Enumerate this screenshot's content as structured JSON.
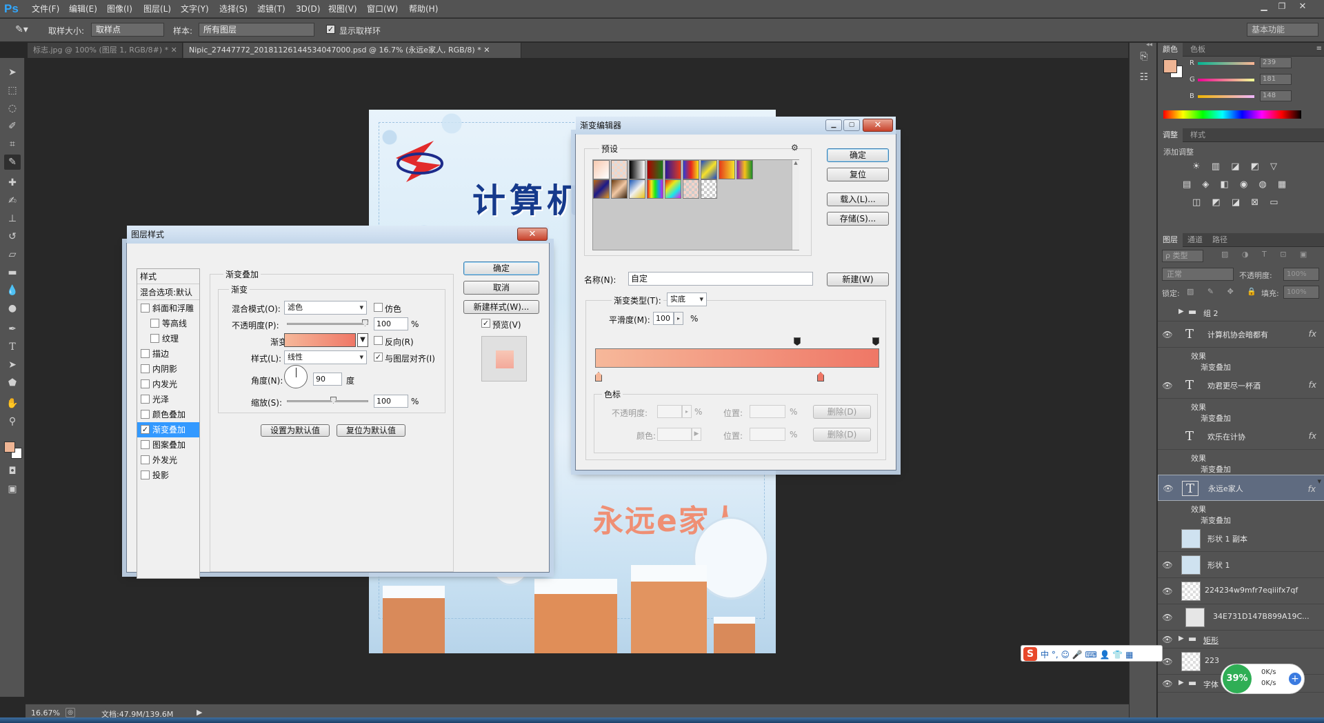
{
  "app": {
    "logo": "Ps"
  },
  "menu": [
    "文件(F)",
    "编辑(E)",
    "图像(I)",
    "图层(L)",
    "文字(Y)",
    "选择(S)",
    "滤镜(T)",
    "3D(D)",
    "视图(V)",
    "窗口(W)",
    "帮助(H)"
  ],
  "options": {
    "sample_size_label": "取样大小:",
    "sample_size_value": "取样点",
    "sample_label": "样本:",
    "sample_value": "所有图层",
    "show_ring_label": "显示取样环",
    "workspace": "基本功能"
  },
  "tabs": [
    {
      "label": "标志.jpg @ 100% (图层 1, RGB/8#) *"
    },
    {
      "label": "Nipic_27447772_20181126144534047000.psd @ 16.7% (永远e家人, RGB/8) *"
    }
  ],
  "status": {
    "zoom": "16.67%",
    "doc": "文档:47.9M/139.6M"
  },
  "doc_texts": {
    "headline": "计算机",
    "family": "永远e家人"
  },
  "color_panel": {
    "tabs": [
      "颜色",
      "色板"
    ],
    "channels": [
      {
        "name": "R",
        "value": "239"
      },
      {
        "name": "G",
        "value": "181"
      },
      {
        "name": "B",
        "value": "148"
      }
    ],
    "fg_color": "#efb594"
  },
  "adjust_panel": {
    "tabs": [
      "调整",
      "样式"
    ],
    "title": "添加调整"
  },
  "layers_panel": {
    "tabs": [
      "图层",
      "通道",
      "路径"
    ],
    "filter_label": "ρ 类型",
    "blend_mode": "正常",
    "opacity_label": "不透明度:",
    "opacity_value": "100%",
    "lock_label": "锁定:",
    "fill_label": "填充:",
    "fill_value": "100%",
    "effect_label": "效果",
    "effect_item": "渐变叠加",
    "layers": [
      {
        "name": "组 2",
        "kind": "group",
        "visible": false
      },
      {
        "name": "计算机协会暗都有",
        "kind": "text",
        "visible": true,
        "fx": true
      },
      {
        "name": "劝君更尽一杯酒",
        "kind": "text",
        "visible": true,
        "fx": true
      },
      {
        "name": "欢乐在计协",
        "kind": "text",
        "visible": false,
        "fx": true
      },
      {
        "name": "永远e家人",
        "kind": "text",
        "visible": true,
        "fx": true,
        "selected": true
      },
      {
        "name": "形状 1 副本",
        "kind": "shape",
        "visible": false
      },
      {
        "name": "形状 1",
        "kind": "shape",
        "visible": true
      },
      {
        "name": "224234w9mfr7eqiiifx7qf",
        "kind": "image",
        "visible": true
      },
      {
        "name": "34E731D147B899A19C...",
        "kind": "image",
        "visible": true
      },
      {
        "name": "矩形",
        "kind": "group",
        "visible": true
      },
      {
        "name": "223",
        "kind": "image",
        "visible": true
      },
      {
        "name": "字体",
        "kind": "group",
        "visible": true
      }
    ]
  },
  "layer_style": {
    "title": "图层样式",
    "close": "✕",
    "list_header": "样式",
    "blend_options": "混合选项:默认",
    "items": [
      {
        "label": "斜面和浮雕",
        "checked": false
      },
      {
        "label": "等高线",
        "checked": false,
        "sub": true
      },
      {
        "label": "纹理",
        "checked": false,
        "sub": true
      },
      {
        "label": "描边",
        "checked": false
      },
      {
        "label": "内阴影",
        "checked": false
      },
      {
        "label": "内发光",
        "checked": false
      },
      {
        "label": "光泽",
        "checked": false
      },
      {
        "label": "颜色叠加",
        "checked": false
      },
      {
        "label": "渐变叠加",
        "checked": true,
        "selected": true
      },
      {
        "label": "图案叠加",
        "checked": false
      },
      {
        "label": "外发光",
        "checked": false
      },
      {
        "label": "投影",
        "checked": false
      }
    ],
    "section_title": "渐变叠加",
    "group_title": "渐变",
    "blend_mode_label": "混合模式(O):",
    "blend_mode_value": "滤色",
    "dither_label": "仿色",
    "opacity_label": "不透明度(P):",
    "opacity_value": "100",
    "gradient_label": "渐变:",
    "reverse_label": "反向(R)",
    "style_label": "样式(L):",
    "style_value": "线性",
    "align_label": "与图层对齐(I)",
    "angle_label": "角度(N):",
    "angle_value": "90",
    "angle_unit": "度",
    "scale_label": "缩放(S):",
    "scale_value": "100",
    "percent": "%",
    "make_default": "设置为默认值",
    "reset_default": "复位为默认值",
    "ok": "确定",
    "cancel": "取消",
    "new_style": "新建样式(W)...",
    "preview_label": "预览(V)",
    "gradient_start": "#f6b89a",
    "gradient_end": "#ef7766"
  },
  "gradient_editor": {
    "title": "渐变编辑器",
    "presets_label": "预设",
    "ok": "确定",
    "reset": "复位",
    "load": "载入(L)...",
    "save": "存储(S)...",
    "name_label": "名称(N):",
    "name_value": "自定",
    "new_btn": "新建(W)",
    "type_label": "渐变类型(T):",
    "type_value": "实底",
    "smooth_label": "平滑度(M):",
    "smooth_value": "100",
    "percent": "%",
    "stops_group": "色标",
    "stop_opacity_label": "不透明度:",
    "stop_color_label": "颜色:",
    "location_label": "位置:",
    "delete_label": "删除(D)",
    "preset_colors": [
      "linear-gradient(135deg,#f7c9b0,#ffffff)",
      "repeating-conic-gradient(#ddd 0 25%,#f5d5c4 0 50%)",
      "linear-gradient(90deg,#000,#fff)",
      "linear-gradient(90deg,#b00000,#1a7a1a)",
      "linear-gradient(90deg,#2b1b9a,#e53a1a)",
      "linear-gradient(90deg,#2c3cd8,#e8251b,#f5e51b)",
      "linear-gradient(135deg,#1a48c8,#f6e12a,#1a48c8)",
      "linear-gradient(90deg,#e53a1a,#f4e42a)",
      "linear-gradient(90deg,#8a1ea8,#f6c21a,#1a8a2a)",
      "linear-gradient(135deg,#c06a10,#1a1a8a,#e89a1a)",
      "linear-gradient(135deg,#6a3a10,#f1c8a4,#3a2410)",
      "linear-gradient(135deg,#1a58b8,#f0f0f0,#e8c21a)",
      "linear-gradient(90deg,#e81a1a,#f6e81a,#1ae81a,#1a9ae8,#c81ae8)",
      "linear-gradient(135deg,#e81a1a,#e8e81a,#1ae8e8,#e81ae8)",
      "repeating-conic-gradient(#ccc 0 25%,#f6d3c8 0 50%)",
      "repeating-conic-gradient(#ccc 0 25%,#fff 0 50%)"
    ]
  },
  "ime": {
    "text": "中 °, ☺ 🎤 ⌨ 👤 👕 ▦"
  },
  "network": {
    "percent": "39%",
    "up": "0K/s",
    "down": "0K/s"
  }
}
